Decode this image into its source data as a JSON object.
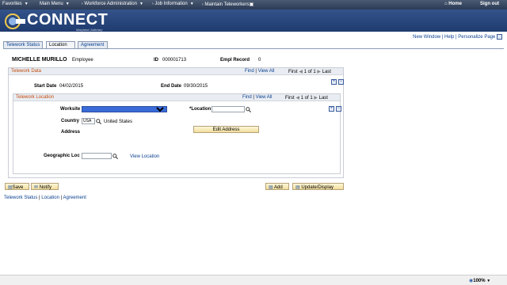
{
  "topnav": {
    "favorites": "Favorites",
    "main_menu": "Main Menu",
    "crumb1": "Workforce Administration",
    "crumb2": "Job Information",
    "crumb3": "Maintain Teleworkers",
    "home": "Home",
    "signout": "Sign out"
  },
  "brand": {
    "name": "CONNECT",
    "subtitle": "Maryland Judiciary"
  },
  "toolbar": {
    "new_window": "New Window",
    "help": "Help",
    "personalize": "Personalize Page"
  },
  "tabs": [
    "Telework Status",
    "Location",
    "Agreement"
  ],
  "employee": {
    "name": "MICHELLE MURILLO",
    "type": "Employee",
    "id_label": "ID",
    "id": "000001713",
    "rec_label": "Empl Record",
    "rec": "0"
  },
  "telework_data": {
    "title": "Telework Data",
    "find": "Find",
    "viewall": "View All",
    "first": "First",
    "counter": "1 of 1",
    "last": "Last",
    "start_label": "Start Date",
    "start": "04/02/2015",
    "end_label": "End Date",
    "end": "09/30/2015"
  },
  "location": {
    "title": "Telework Location",
    "find": "Find",
    "viewall": "View All",
    "first": "First",
    "counter": "1 of 1",
    "last": "Last",
    "worksite_label": "Worksite",
    "location_label": "*Location",
    "country_label": "Country",
    "country_code": "USA",
    "country_name": "United States",
    "address_label": "Address",
    "edit_address": "Edit Address",
    "geo_label": "Geographic Loc",
    "view_location": "View Location"
  },
  "buttons": {
    "save": "Save",
    "notify": "Notify",
    "add": "Add",
    "update": "Update/Display"
  },
  "bottom_links": [
    "Telework Status",
    "Location",
    "Agreement"
  ],
  "status": {
    "zoom": "100%"
  }
}
